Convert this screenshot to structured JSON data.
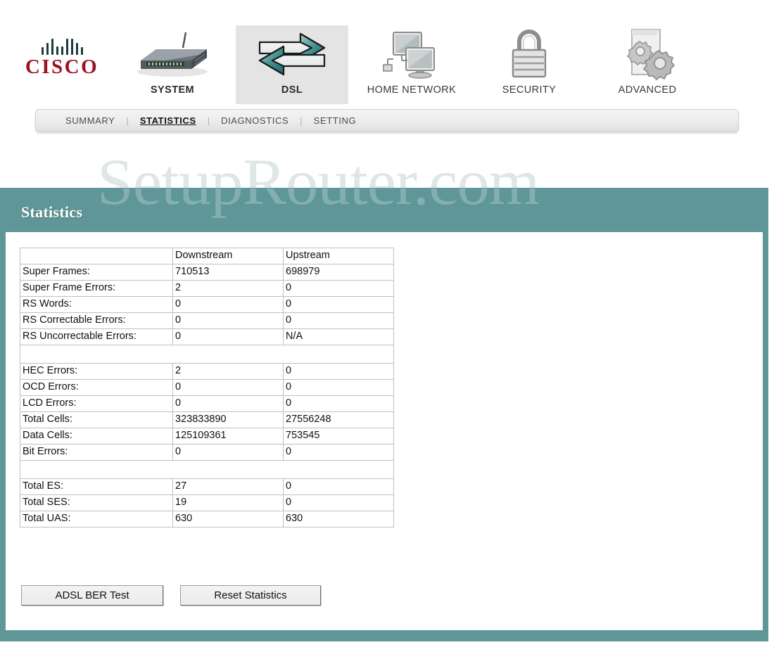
{
  "brand": {
    "name": "CISCO",
    "logo_bar_color": "#1c3b3d",
    "wordmark_color": "#9c1321"
  },
  "watermark": {
    "text": "SetupRouter.com"
  },
  "topnav": {
    "items": [
      {
        "label": "SYSTEM",
        "icon": "router-icon",
        "active": false
      },
      {
        "label": "DSL",
        "icon": "bidirectional-arrows-icon",
        "active": true
      },
      {
        "label": "HOME NETWORK",
        "icon": "computers-network-icon",
        "active": false
      },
      {
        "label": "SECURITY",
        "icon": "padlock-icon",
        "active": false
      },
      {
        "label": "ADVANCED",
        "icon": "gears-document-icon",
        "active": false
      }
    ]
  },
  "subnav": {
    "separator": "|",
    "items": [
      {
        "label": "SUMMARY",
        "active": false
      },
      {
        "label": "STATISTICS",
        "active": true
      },
      {
        "label": "DIAGNOSTICS",
        "active": false
      },
      {
        "label": "SETTING",
        "active": false
      }
    ]
  },
  "panel": {
    "title": "Statistics",
    "accent_color": "#5f9698"
  },
  "table": {
    "headers": [
      "",
      "Downstream",
      "Upstream"
    ],
    "rows": [
      {
        "type": "header",
        "cells": [
          "",
          "Downstream",
          "Upstream"
        ]
      },
      {
        "type": "data",
        "cells": [
          "Super Frames:",
          "710513",
          "698979"
        ]
      },
      {
        "type": "data",
        "cells": [
          "Super Frame Errors:",
          "2",
          "0"
        ]
      },
      {
        "type": "data",
        "cells": [
          "RS Words:",
          "0",
          "0"
        ]
      },
      {
        "type": "data",
        "cells": [
          "RS Correctable Errors:",
          "0",
          "0"
        ]
      },
      {
        "type": "data",
        "cells": [
          "RS Uncorrectable Errors:",
          "0",
          "N/A"
        ]
      },
      {
        "type": "spacer",
        "cells": [
          "",
          "",
          ""
        ]
      },
      {
        "type": "data",
        "cells": [
          "HEC Errors:",
          "2",
          "0"
        ]
      },
      {
        "type": "data",
        "cells": [
          "OCD Errors:",
          "0",
          "0"
        ]
      },
      {
        "type": "data",
        "cells": [
          "LCD Errors:",
          "0",
          "0"
        ]
      },
      {
        "type": "data",
        "cells": [
          "Total Cells:",
          "323833890",
          "27556248"
        ]
      },
      {
        "type": "data",
        "cells": [
          "Data Cells:",
          "125109361",
          "753545"
        ]
      },
      {
        "type": "data",
        "cells": [
          "Bit Errors:",
          "0",
          "0"
        ]
      },
      {
        "type": "spacer",
        "cells": [
          "",
          "",
          ""
        ]
      },
      {
        "type": "data",
        "cells": [
          "Total ES:",
          "27",
          "0"
        ]
      },
      {
        "type": "data",
        "cells": [
          "Total SES:",
          "19",
          "0"
        ]
      },
      {
        "type": "data",
        "cells": [
          "Total UAS:",
          "630",
          "630"
        ]
      }
    ]
  },
  "buttons": {
    "adsl_ber_test": "ADSL BER Test",
    "reset_statistics": "Reset Statistics"
  }
}
